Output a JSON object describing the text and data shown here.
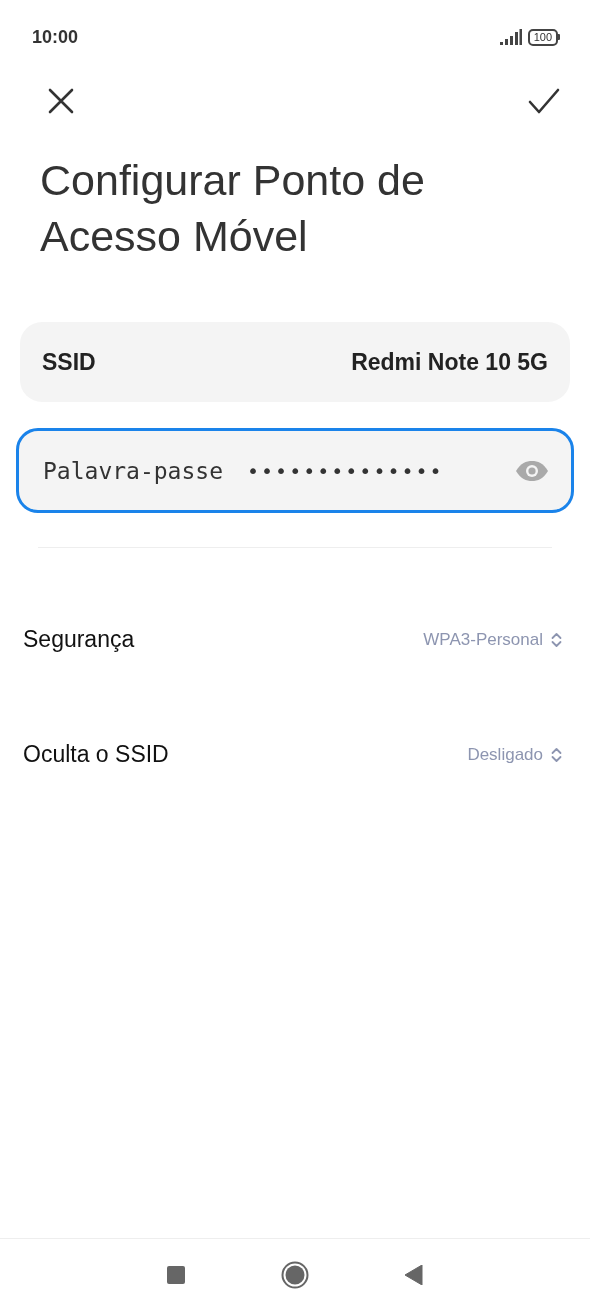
{
  "status_bar": {
    "time": "10:00",
    "battery": "100"
  },
  "title": "Configurar Ponto de Acesso Móvel",
  "ssid": {
    "label": "SSID",
    "value": "Redmi Note 10 5G"
  },
  "password": {
    "label": "Palavra-passe",
    "value": "••••••••••••••",
    "focused": true
  },
  "settings": [
    {
      "label": "Segurança",
      "value": "WPA3-Personal"
    },
    {
      "label": "Oculta o SSID",
      "value": "Desligado"
    }
  ]
}
